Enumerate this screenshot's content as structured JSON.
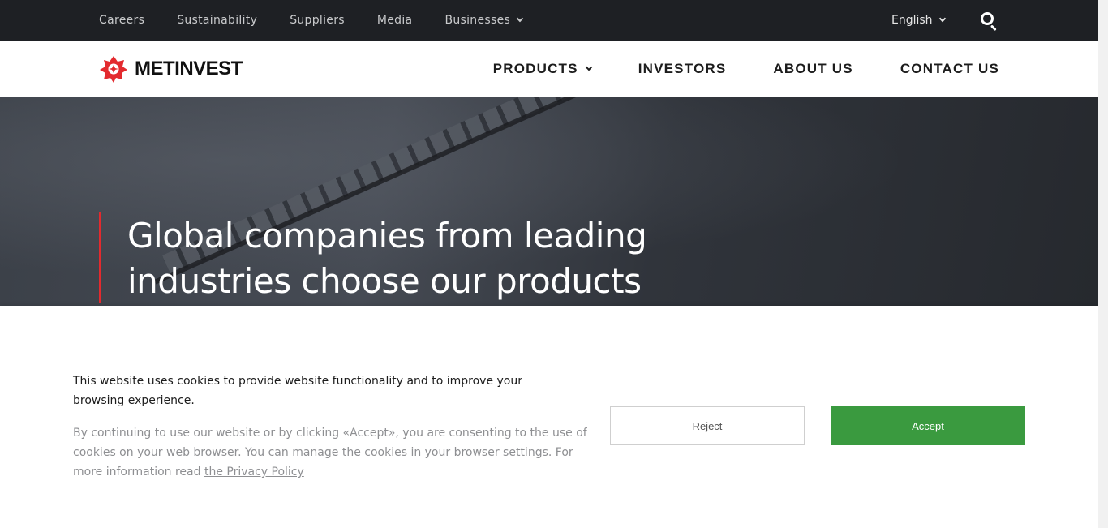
{
  "topbar": {
    "links": [
      "Careers",
      "Sustainability",
      "Suppliers",
      "Media"
    ],
    "businesses_label": "Businesses",
    "language": "English"
  },
  "header": {
    "logo_text": "METINVEST",
    "nav": {
      "products": "PRODUCTS",
      "investors": "INVESTORS",
      "about": "ABOUT US",
      "contact": "CONTACT US"
    }
  },
  "hero": {
    "headline": "Global companies from leading industries choose our products"
  },
  "cookie": {
    "title": "This website uses cookies to provide website functionality and to improve your browsing experience.",
    "description": "By continuing to use our website or by clicking «Accept», you are consenting to the use of cookies on your web browser. You can manage the cookies in your browser settings. For more information read ",
    "privacy_link": "the Privacy Policy",
    "reject_label": "Reject",
    "accept_label": "Accept"
  },
  "colors": {
    "accent_red": "#e32a2e",
    "accept_green": "#3a9a3f",
    "topbar_bg": "#1e2024"
  },
  "icons": [
    "chevron-down-icon",
    "search-icon",
    "metinvest-logo-icon"
  ]
}
